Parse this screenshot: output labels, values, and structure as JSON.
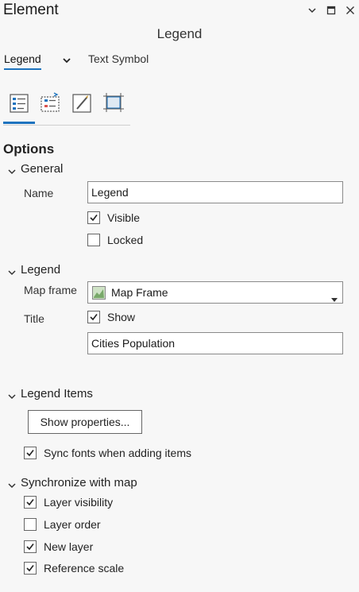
{
  "window": {
    "title": "Element"
  },
  "header": {
    "subtitle": "Legend"
  },
  "tabs": [
    {
      "label": "Legend"
    },
    {
      "label": "Text Symbol"
    }
  ],
  "toolbar_icons": [
    "legend-options-icon",
    "legend-arrange-icon",
    "symbol-icon",
    "display-icon"
  ],
  "options": {
    "heading": "Options",
    "general": {
      "heading": "General",
      "name_label": "Name",
      "name_value": "Legend",
      "visible_label": "Visible",
      "visible_checked": true,
      "locked_label": "Locked",
      "locked_checked": false
    },
    "legend": {
      "heading": "Legend",
      "map_frame_label": "Map frame",
      "map_frame_value": "Map Frame",
      "title_label": "Title",
      "show_label": "Show",
      "show_checked": true,
      "title_value": "Cities Population"
    },
    "legend_items": {
      "heading": "Legend Items",
      "show_properties_label": "Show properties...",
      "sync_fonts_label": "Sync fonts when adding items",
      "sync_fonts_checked": true
    },
    "sync_map": {
      "heading": "Synchronize with map",
      "items": [
        {
          "label": "Layer visibility",
          "checked": true
        },
        {
          "label": "Layer order",
          "checked": false
        },
        {
          "label": "New layer",
          "checked": true
        },
        {
          "label": "Reference scale",
          "checked": true
        }
      ]
    }
  },
  "colors": {
    "accent": "#1e73be",
    "background": "#f7f7f7"
  }
}
